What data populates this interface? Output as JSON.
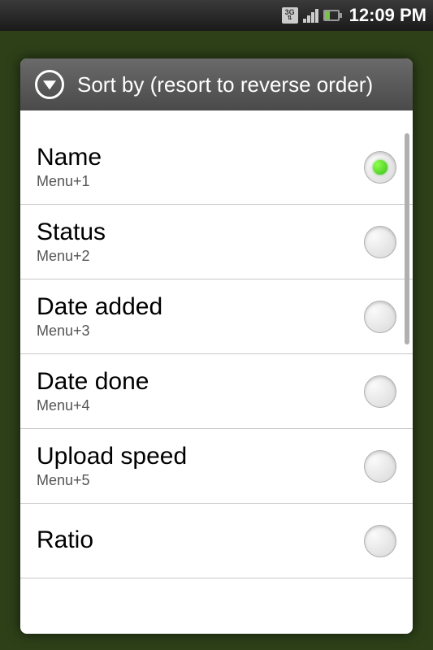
{
  "statusBar": {
    "time": "12:09 PM"
  },
  "dialog": {
    "title": "Sort by (resort to reverse order)",
    "options": [
      {
        "label": "Name",
        "shortcut": "Menu+1",
        "selected": true
      },
      {
        "label": "Status",
        "shortcut": "Menu+2",
        "selected": false
      },
      {
        "label": "Date added",
        "shortcut": "Menu+3",
        "selected": false
      },
      {
        "label": "Date done",
        "shortcut": "Menu+4",
        "selected": false
      },
      {
        "label": "Upload speed",
        "shortcut": "Menu+5",
        "selected": false
      },
      {
        "label": "Ratio",
        "shortcut": "",
        "selected": false
      }
    ]
  }
}
